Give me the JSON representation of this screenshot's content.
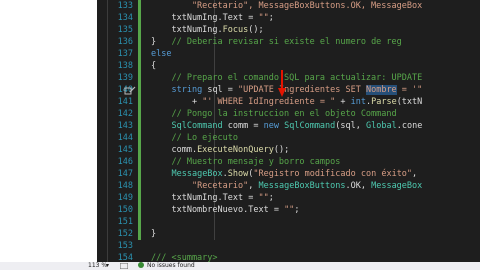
{
  "editor": {
    "lines": [
      {
        "num": "133",
        "segs": [
          {
            "t": "        \"Recetario\", MessageBoxButtons.OK, MessageBox",
            "c": "str"
          }
        ]
      },
      {
        "num": "134",
        "segs": [
          {
            "t": "    txtNumIng.Text = ",
            "c": ""
          },
          {
            "t": "\"\"",
            "c": "str"
          },
          {
            "t": ";",
            "c": ""
          }
        ]
      },
      {
        "num": "135",
        "segs": [
          {
            "t": "    txtNumIng.",
            "c": ""
          },
          {
            "t": "Focus",
            "c": "mth"
          },
          {
            "t": "();",
            "c": ""
          }
        ]
      },
      {
        "num": "136",
        "segs": [
          {
            "t": "}   ",
            "c": ""
          },
          {
            "t": "// Deberia revisar si existe el numero de reg",
            "c": "cm"
          }
        ]
      },
      {
        "num": "137",
        "segs": [
          {
            "t": "else",
            "c": "kw"
          }
        ]
      },
      {
        "num": "138",
        "segs": [
          {
            "t": "{",
            "c": ""
          }
        ]
      },
      {
        "num": "139",
        "segs": [
          {
            "t": "    // Preparo el comando SQL para actualizar: UPDATE",
            "c": "cm"
          }
        ]
      },
      {
        "num": "140",
        "segs": [
          {
            "t": "    ",
            "c": ""
          },
          {
            "t": "string",
            "c": "kw"
          },
          {
            "t": " sql = ",
            "c": ""
          },
          {
            "t": "\"UPDATE Ingredientes SET ",
            "c": "str"
          },
          {
            "t": "Nombre",
            "c": "str hl"
          },
          {
            "t": " = '\"",
            "c": "str"
          }
        ]
      },
      {
        "num": "141",
        "segs": [
          {
            "t": "        + ",
            "c": ""
          },
          {
            "t": "\"' WHERE IdIngrediente = \"",
            "c": "str"
          },
          {
            "t": " + ",
            "c": ""
          },
          {
            "t": "int",
            "c": "kw"
          },
          {
            "t": ".",
            "c": ""
          },
          {
            "t": "Parse",
            "c": "mth"
          },
          {
            "t": "(txtN",
            "c": ""
          }
        ]
      },
      {
        "num": "142",
        "segs": [
          {
            "t": "    // Pongo la instruccion en el objeto Command",
            "c": "cm"
          }
        ]
      },
      {
        "num": "143",
        "segs": [
          {
            "t": "    ",
            "c": ""
          },
          {
            "t": "SqlCommand",
            "c": "ty"
          },
          {
            "t": " comm = ",
            "c": ""
          },
          {
            "t": "new",
            "c": "kw"
          },
          {
            "t": " ",
            "c": ""
          },
          {
            "t": "SqlCommand",
            "c": "ty"
          },
          {
            "t": "(sql, ",
            "c": ""
          },
          {
            "t": "Global",
            "c": "ty"
          },
          {
            "t": ".cone",
            "c": ""
          }
        ]
      },
      {
        "num": "144",
        "segs": [
          {
            "t": "    // Lo ejecuto",
            "c": "cm"
          }
        ]
      },
      {
        "num": "145",
        "segs": [
          {
            "t": "    comm.",
            "c": ""
          },
          {
            "t": "ExecuteNonQuery",
            "c": "mth"
          },
          {
            "t": "();",
            "c": ""
          }
        ]
      },
      {
        "num": "146",
        "segs": [
          {
            "t": "    // Muestro mensaje y borro campos",
            "c": "cm"
          }
        ]
      },
      {
        "num": "147",
        "segs": [
          {
            "t": "    ",
            "c": ""
          },
          {
            "t": "MessageBox",
            "c": "ty"
          },
          {
            "t": ".",
            "c": ""
          },
          {
            "t": "Show",
            "c": "mth"
          },
          {
            "t": "(",
            "c": ""
          },
          {
            "t": "\"Registro modificado con éxito\"",
            "c": "str"
          },
          {
            "t": ",",
            "c": ""
          }
        ]
      },
      {
        "num": "148",
        "segs": [
          {
            "t": "        ",
            "c": ""
          },
          {
            "t": "\"Recetario\"",
            "c": "str"
          },
          {
            "t": ", ",
            "c": ""
          },
          {
            "t": "MessageBoxButtons",
            "c": "ty"
          },
          {
            "t": ".OK, ",
            "c": ""
          },
          {
            "t": "MessageBox",
            "c": "ty"
          }
        ]
      },
      {
        "num": "149",
        "segs": [
          {
            "t": "    txtNumIng.Text = ",
            "c": ""
          },
          {
            "t": "\"\"",
            "c": "str"
          },
          {
            "t": ";",
            "c": ""
          }
        ]
      },
      {
        "num": "150",
        "segs": [
          {
            "t": "    txtNombreNuevo.Text = ",
            "c": ""
          },
          {
            "t": "\"\"",
            "c": "str"
          },
          {
            "t": ";",
            "c": ""
          }
        ]
      },
      {
        "num": "151",
        "segs": [
          {
            "t": "",
            "c": ""
          }
        ]
      },
      {
        "num": "152",
        "segs": [
          {
            "t": "}",
            "c": ""
          }
        ]
      },
      {
        "num": "153",
        "segs": [
          {
            "t": "",
            "c": ""
          }
        ]
      },
      {
        "num": "154",
        "segs": [
          {
            "t": "/// <summary>",
            "c": "cm"
          }
        ]
      }
    ]
  },
  "status": {
    "zoom": "113 %",
    "issues": "No issues found"
  },
  "colors": {
    "background": "#1e1e1e",
    "comment": "#57a64a",
    "keyword": "#569cd6",
    "string": "#d69d85",
    "type": "#4ec9b0",
    "arrow": "#e51400"
  }
}
